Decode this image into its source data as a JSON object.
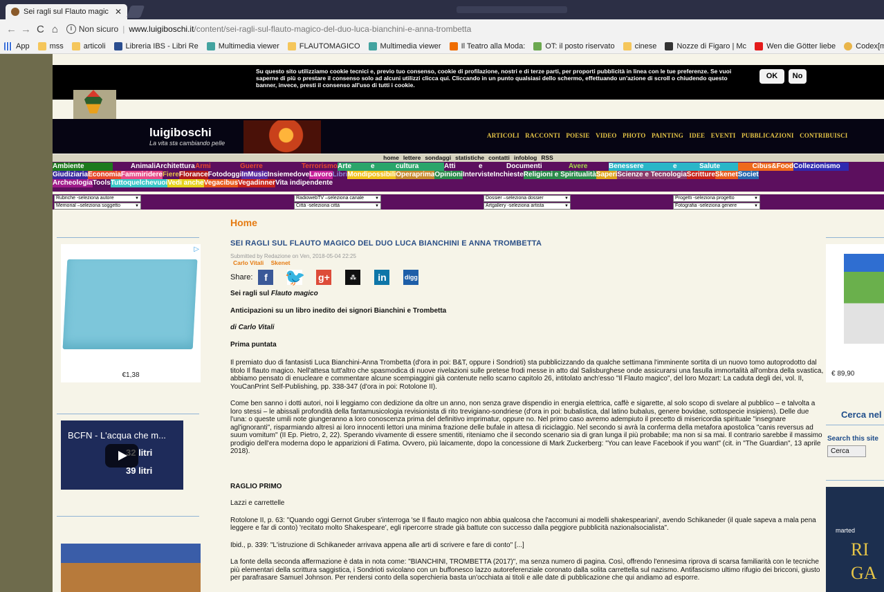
{
  "browser": {
    "tab_title": "Sei ragli sul Flauto magic",
    "tab_close": "✕",
    "nav": {
      "back": "←",
      "forward": "→",
      "reload": "C",
      "home": "⌂"
    },
    "security_label": "Non sicuro",
    "url_host": "www.luigiboschi.it",
    "url_path": "/content/sei-ragli-sul-flauto-magico-del-duo-luca-bianchini-e-anna-trombetta",
    "bookmarks": [
      {
        "label": "App",
        "icon": "grid"
      },
      {
        "label": "mss",
        "icon": "folder"
      },
      {
        "label": "articoli",
        "icon": "folder"
      },
      {
        "label": "Libreria IBS - Libri Re",
        "icon": "ibs"
      },
      {
        "label": "Multimedia viewer",
        "icon": "mm"
      },
      {
        "label": "FLAUTOMAGICO",
        "icon": "folder"
      },
      {
        "label": "Multimedia viewer",
        "icon": "mm"
      },
      {
        "label": "Il Teatro alla Moda:",
        "icon": "blog"
      },
      {
        "label": "OT: il posto riservato",
        "icon": "chat"
      },
      {
        "label": "cinese",
        "icon": "folder"
      },
      {
        "label": "Nozze di Figaro | Mc",
        "icon": "pic"
      },
      {
        "label": "Wen die Götter liebe",
        "icon": "yt"
      },
      {
        "label": "Codex[ml] - XML Na",
        "icon": "cx"
      }
    ]
  },
  "cookie": {
    "text": "Su questo sito utilizziamo cookie tecnici e, previo tuo consenso, cookie di profilazione, nostri e di terze parti, per proporti pubblicità in linea con le tue preferenze. Se vuoi saperne di più o prestare il consenso solo ad alcuni utilizzi clicca qui. Cliccando in un punto qualsiasi dello schermo, effettuando un'azione di scroll o chiudendo questo banner, invece, presti il consenso all'uso di tutti i cookie.",
    "ok": "OK",
    "no": "No"
  },
  "site": {
    "title": "luigiboschi",
    "tagline": "La vita sta cambiando pelle",
    "nav": [
      "ARTICOLI",
      "RACCONTI",
      "POESIE",
      "VIDEO",
      "PHOTO",
      "PAINTING",
      "IDEE",
      "EVENTI",
      "PUBBLICAZIONI",
      "CONTRIBUISCI"
    ],
    "subnav": [
      "home",
      "lettere",
      "sondaggi",
      "statistiche",
      "contatti",
      "infoblog",
      "RSS"
    ]
  },
  "categories": {
    "row1": [
      {
        "label": "Ambiente",
        "bg": "#1d7a1d",
        "color": "#ffffff",
        "w": 87
      },
      {
        "label": "Animali",
        "bg": "#5c0f5e",
        "color": "#ffffff",
        "w": 62,
        "align": "right"
      },
      {
        "label": "Architettura",
        "bg": "#5c0f5e",
        "color": "#ffffff",
        "w": 57
      },
      {
        "label": "Armi",
        "bg": "#5c0f5e",
        "color": "#e84a2c",
        "w": 65
      },
      {
        "label": "Guerre",
        "bg": "#5c0f5e",
        "color": "#e84a2c",
        "w": 80
      },
      {
        "label": "Terrorismo",
        "bg": "#5c0f5e",
        "color": "#e84a2c",
        "w": 61,
        "align": "right"
      },
      {
        "label": "Arte",
        "bg": "#2aa56a",
        "color": "#ffffff",
        "w": 48
      },
      {
        "label": "e",
        "bg": "#2aa56a",
        "color": "#ffffff",
        "w": 36
      },
      {
        "label": "cultura",
        "bg": "#2aa56a",
        "color": "#ffffff",
        "w": 70
      },
      {
        "label": "Atti",
        "bg": "#5c0f5e",
        "color": "#ffffff",
        "w": 50
      },
      {
        "label": "e",
        "bg": "#5c0f5e",
        "color": "#ffffff",
        "w": 40
      },
      {
        "label": "Documenti",
        "bg": "#5c0f5e",
        "color": "#ffffff",
        "w": 90
      },
      {
        "label": "Avere",
        "bg": "#5c0f5e",
        "color": "#a6d94a",
        "w": 58
      },
      {
        "label": "Benessere",
        "bg": "#2ab6c8",
        "color": "#ffffff",
        "w": 93
      },
      {
        "label": "e",
        "bg": "#2ab6c8",
        "color": "#ffffff",
        "w": 38
      },
      {
        "label": "Salute",
        "bg": "#2ab6c8",
        "color": "#ffffff",
        "w": 56
      },
      {
        "label": "Cibus&Food",
        "bg": "#ef6a1c",
        "color": "#ffffff",
        "w": 80,
        "align": "right"
      },
      {
        "label": "Collezionismo",
        "bg": "#2f2ab0",
        "color": "#ffffff",
        "w": 80
      }
    ],
    "row2": [
      {
        "label": "Giudiziaria",
        "bg": "#3a2a9e",
        "color": "#ffffff"
      },
      {
        "label": "Economia",
        "bg": "#e84a2c",
        "color": "#ffffff"
      },
      {
        "label": "Fammiridere",
        "bg": "#e84a87",
        "color": "#ffffff"
      },
      {
        "label": "Fiere",
        "bg": "#5c0f5e",
        "color": "#e6c547"
      },
      {
        "label": "Florance",
        "bg": "#b01a1a",
        "color": "#ffffff"
      },
      {
        "label": "Fotodoggi",
        "bg": "#5c0f5e",
        "color": "#ffffff"
      },
      {
        "label": "InMusic",
        "bg": "#5a2aa0",
        "color": "#ffffff"
      },
      {
        "label": "Insiemedove",
        "bg": "#5c0f5e",
        "color": "#ffffff"
      },
      {
        "label": "Lavoro",
        "bg": "#c8239b",
        "color": "#ffffff"
      },
      {
        "label": "Libri",
        "bg": "#5c0f5e",
        "color": "#8a8ad8"
      },
      {
        "label": "Mondipossibili",
        "bg": "#f3c21d",
        "color": "#ffffff"
      },
      {
        "label": " Operaprima",
        "bg": "#c88a2e",
        "color": "#ffffff"
      },
      {
        "label": "Opinioni",
        "bg": "#2a8a4a",
        "color": "#ffffff"
      },
      {
        "label": " Interviste ",
        "bg": "#5c0f5e",
        "color": "#ffffff"
      },
      {
        "label": "Inchieste",
        "bg": "#5c0f5e",
        "color": "#ffffff"
      },
      {
        "label": "Religioni e Spiritualità",
        "bg": "#2a8a4a",
        "color": "#ffffff"
      },
      {
        "label": " Saperi",
        "bg": "#e0a51d",
        "color": "#ffffff"
      },
      {
        "label": "Scienze e Tecnologia",
        "bg": "#8a3a6a",
        "color": "#ffffff"
      },
      {
        "label": " Scritture",
        "bg": "#c8231a",
        "color": "#ffffff"
      },
      {
        "label": "Skenet",
        "bg": "#e85a1c",
        "color": "#ffffff"
      },
      {
        "label": "Societ",
        "bg": "#2a6ab0",
        "color": "#ffffff"
      }
    ],
    "row3": [
      {
        "label": "Archeologia",
        "bg": "#a01a8a",
        "color": "#ffffff"
      },
      {
        "label": "Tools",
        "bg": "#5c0f5e",
        "color": "#ffffff"
      },
      {
        "label": "Tuttoquelchevuoi",
        "bg": "#3ac8c8",
        "color": "#ffffff"
      },
      {
        "label": "Vedi anche",
        "bg": "#e6d21d",
        "color": "#ffffff"
      },
      {
        "label": "Vegacibus",
        "bg": "#e85a1c",
        "color": "#ffffff"
      },
      {
        "label": "Vegadinner",
        "bg": "#c8231a",
        "color": "#ffffff"
      },
      {
        "label": "Vita indipendente",
        "bg": "#5c0f5e",
        "color": "#ffffff"
      }
    ]
  },
  "selects": [
    "Rubriche -seleziona autore",
    "Memorial –seleziona soggetto",
    "RadiowebTV –seleziona canale",
    "Città -seleziona città",
    "Dossier –seleziona dossier",
    "Artgallery -seleziona artista",
    "Progetti -seleziona progetto",
    "Fotografia -seleziona genere"
  ],
  "left": {
    "ad_price": "€1,38",
    "video_title": "BCFN - L'acqua che m...",
    "video_big": "32 litri\n39 litri"
  },
  "right": {
    "ad_price": "€ 89,90",
    "search_title": "Cerca nel",
    "search_label": "Search this site",
    "search_button": "Cerca",
    "ad3_text": "marted",
    "ad3_big": "RI\nGA"
  },
  "article": {
    "breadcrumb": "Home",
    "title": "SEI RAGLI SUL FLAUTO MAGICO DEL DUO LUCA BIANCHINI E ANNA TROMBETTA",
    "submitted": "Submitted by Redazione on Ven, 2018-05-04 22:25",
    "tags": [
      "Carlo Vitali",
      "Skenet"
    ],
    "share_label": "Share:",
    "share_icons": [
      "f",
      "🐦",
      "g+",
      "⁂",
      "in",
      "digg"
    ],
    "h1": "Sei ragli sul ",
    "h1_ital": "Flauto magico",
    "h2": "Anticipazioni su un libro inedito dei signori Bianchini e Trombetta",
    "author": "di Carlo Vitali",
    "part": "Prima puntata",
    "p1": "Il premiato duo di fantasisti Luca Bianchini-Anna Trombetta (d'ora in poi: B&T, oppure i Sondrioti) sta pubblicizzando da qualche settimana l'imminente sortita di un nuovo tomo autoprodotto dal titolo Il flauto magico. Nell'attesa tutt'altro che spasmodica di nuove rivelazioni sulle pretese frodi messe in atto dal Salisburghese onde assicurarsi una fasulla immortalità all'ombra della svastica, abbiamo pensato di enucleare e commentare alcune scempiaggini già contenute nello scarno capitolo 26, intitolato anch'esso \"Il Flauto magico\", del loro Mozart: La caduta degli dei, vol. II, YouCanPrint Self-Publishing, pp. 338-347 (d'ora in poi: Rotolone II).",
    "p2": "Come ben sanno i dotti autori, noi li leggiamo con dedizione da oltre un anno, non senza grave dispendio in energia elettrica, caffè e sigarette, al solo scopo di svelare al pubblico – e talvolta a loro stessi – le abissali profondità della fantamusicologia revisionista di rito trevigiano-sondriese (d'ora in poi: bubalistica, dal latino bubalus, genere bovidae, sottospecie insipiens). Delle due l'una: o queste umili note giungeranno a loro conoscenza prima del definitivo imprimatur, oppure no. Nel primo caso avremo adempiuto il precetto di misericordia spirituale \"insegnare agl'ignoranti\", risparmiando altresì ai loro innocenti lettori una minima frazione delle bufale in attesa di riciclaggio. Nel secondo si avrà la conferma della metafora apostolica \"canis reversus ad suum vomitum\" (II Ep. Pietro, 2, 22). Sperando vivamente di essere smentiti, riteniamo che il secondo scenario sia di gran lunga il più probabile; ma non si sa mai. Il contrario sarebbe il massimo prodigio dell'era moderna dopo le apparizioni di Fatima. Ovvero, più laicamente, dopo la concessione di Mark Zuckerberg: \"You can leave Facebook if you want\" (cit. in \"The Guardian\", 13 aprile 2018).",
    "raglio": "RAGLIO PRIMO",
    "lazzi": "Lazzi e carrettelle",
    "p3": "Rotolone II, p. 63: \"Quando oggi Gernot Gruber s'interroga 'se Il flauto magico non abbia qualcosa che l'accomuni ai modelli shakespeariani', avendo Schikaneder (il quale sapeva a mala pena leggere e far di conto) 'recitato molto Shakespeare', egli ripercorre strade già battute con successo dalla peggiore pubblicità nazionalsocialista\".",
    "p4": "Ibid., p. 339: \"L'istruzione di Schikaneder arrivava appena alle arti di scrivere e fare di conto\" [...]",
    "p5": "La fonte della seconda affermazione è data in nota come: \"BIANCHINI, TROMBETTA (2017)\", ma senza numero di pagina. Così, offrendo l'ennesima riprova di scarsa familiarità con le tecniche più elementari della scrittura saggistica, i Sondrioti svicolano con un buffonesco lazzo autoreferenziale coronato dalla solita carrettella sul nazismo. Antifascismo ultimo rifugio dei bricconi, giusto per parafrasare Samuel Johnson. Per rendersi conto della soperchieria basta un'occhiata ai titoli e alle date di pubblicazione che qui andiamo ad esporre."
  }
}
